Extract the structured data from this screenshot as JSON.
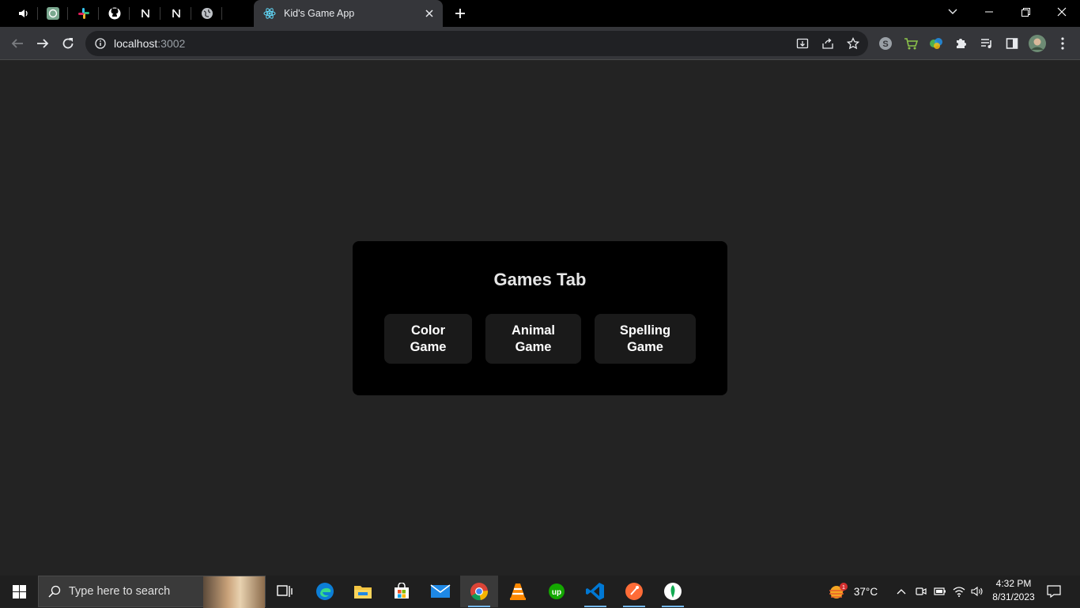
{
  "browser": {
    "active_tab_title": "Kid's Game App",
    "url_host": "localhost",
    "url_port": ":3002",
    "pinned_tabs": [
      {
        "icon": "speaker-icon"
      },
      {
        "icon": "chatgpt-icon"
      },
      {
        "icon": "slack-icon"
      },
      {
        "icon": "github-icon"
      },
      {
        "icon": "notion-icon"
      },
      {
        "icon": "notion-icon"
      },
      {
        "icon": "globe-icon"
      }
    ]
  },
  "page": {
    "heading": "Games Tab",
    "games": [
      {
        "line1": "Color",
        "line2": "Game"
      },
      {
        "line1": "Animal",
        "line2": "Game"
      },
      {
        "line1": "Spelling",
        "line2": "Game"
      }
    ]
  },
  "taskbar": {
    "search_placeholder": "Type here to search",
    "temperature": "37°C",
    "weather_badge": "1",
    "time": "4:32 PM",
    "date": "8/31/2023"
  },
  "colors": {
    "page_bg": "#232323",
    "card_bg": "#000000",
    "button_bg": "#1a1a1a",
    "toolbar_bg": "#35363a"
  }
}
